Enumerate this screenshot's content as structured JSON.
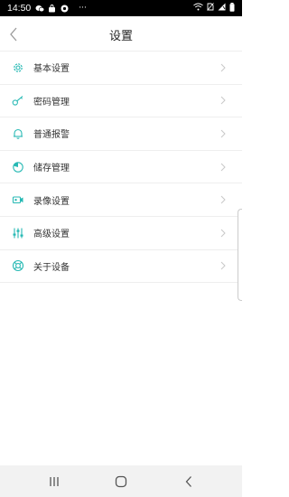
{
  "status_bar": {
    "time": "14:50",
    "dots": "···",
    "icons_left": [
      "chat-icon",
      "bag-icon",
      "shield-icon"
    ],
    "icons_right": [
      "wifi-icon",
      "no-sim-icon",
      "signal-icon",
      "battery-icon"
    ]
  },
  "header": {
    "title": "设置",
    "back_icon": "back-chevron-icon"
  },
  "menu": {
    "items": [
      {
        "label": "基本设置",
        "icon": "gear-icon"
      },
      {
        "label": "密码管理",
        "icon": "key-icon"
      },
      {
        "label": "普通报警",
        "icon": "bell-icon"
      },
      {
        "label": "储存管理",
        "icon": "pie-chart-icon"
      },
      {
        "label": "录像设置",
        "icon": "video-camera-icon"
      },
      {
        "label": "高级设置",
        "icon": "sliders-icon"
      },
      {
        "label": "关于设备",
        "icon": "lifebuoy-icon"
      }
    ]
  },
  "nav_bar": {
    "buttons": [
      "recents-icon",
      "home-icon",
      "back-icon"
    ]
  },
  "colors": {
    "accent": "#27b9b4",
    "text": "#333333",
    "divider": "#eeeeee",
    "chevron": "#c8c8c8",
    "nav_bar_bg": "#f2f2f2"
  }
}
